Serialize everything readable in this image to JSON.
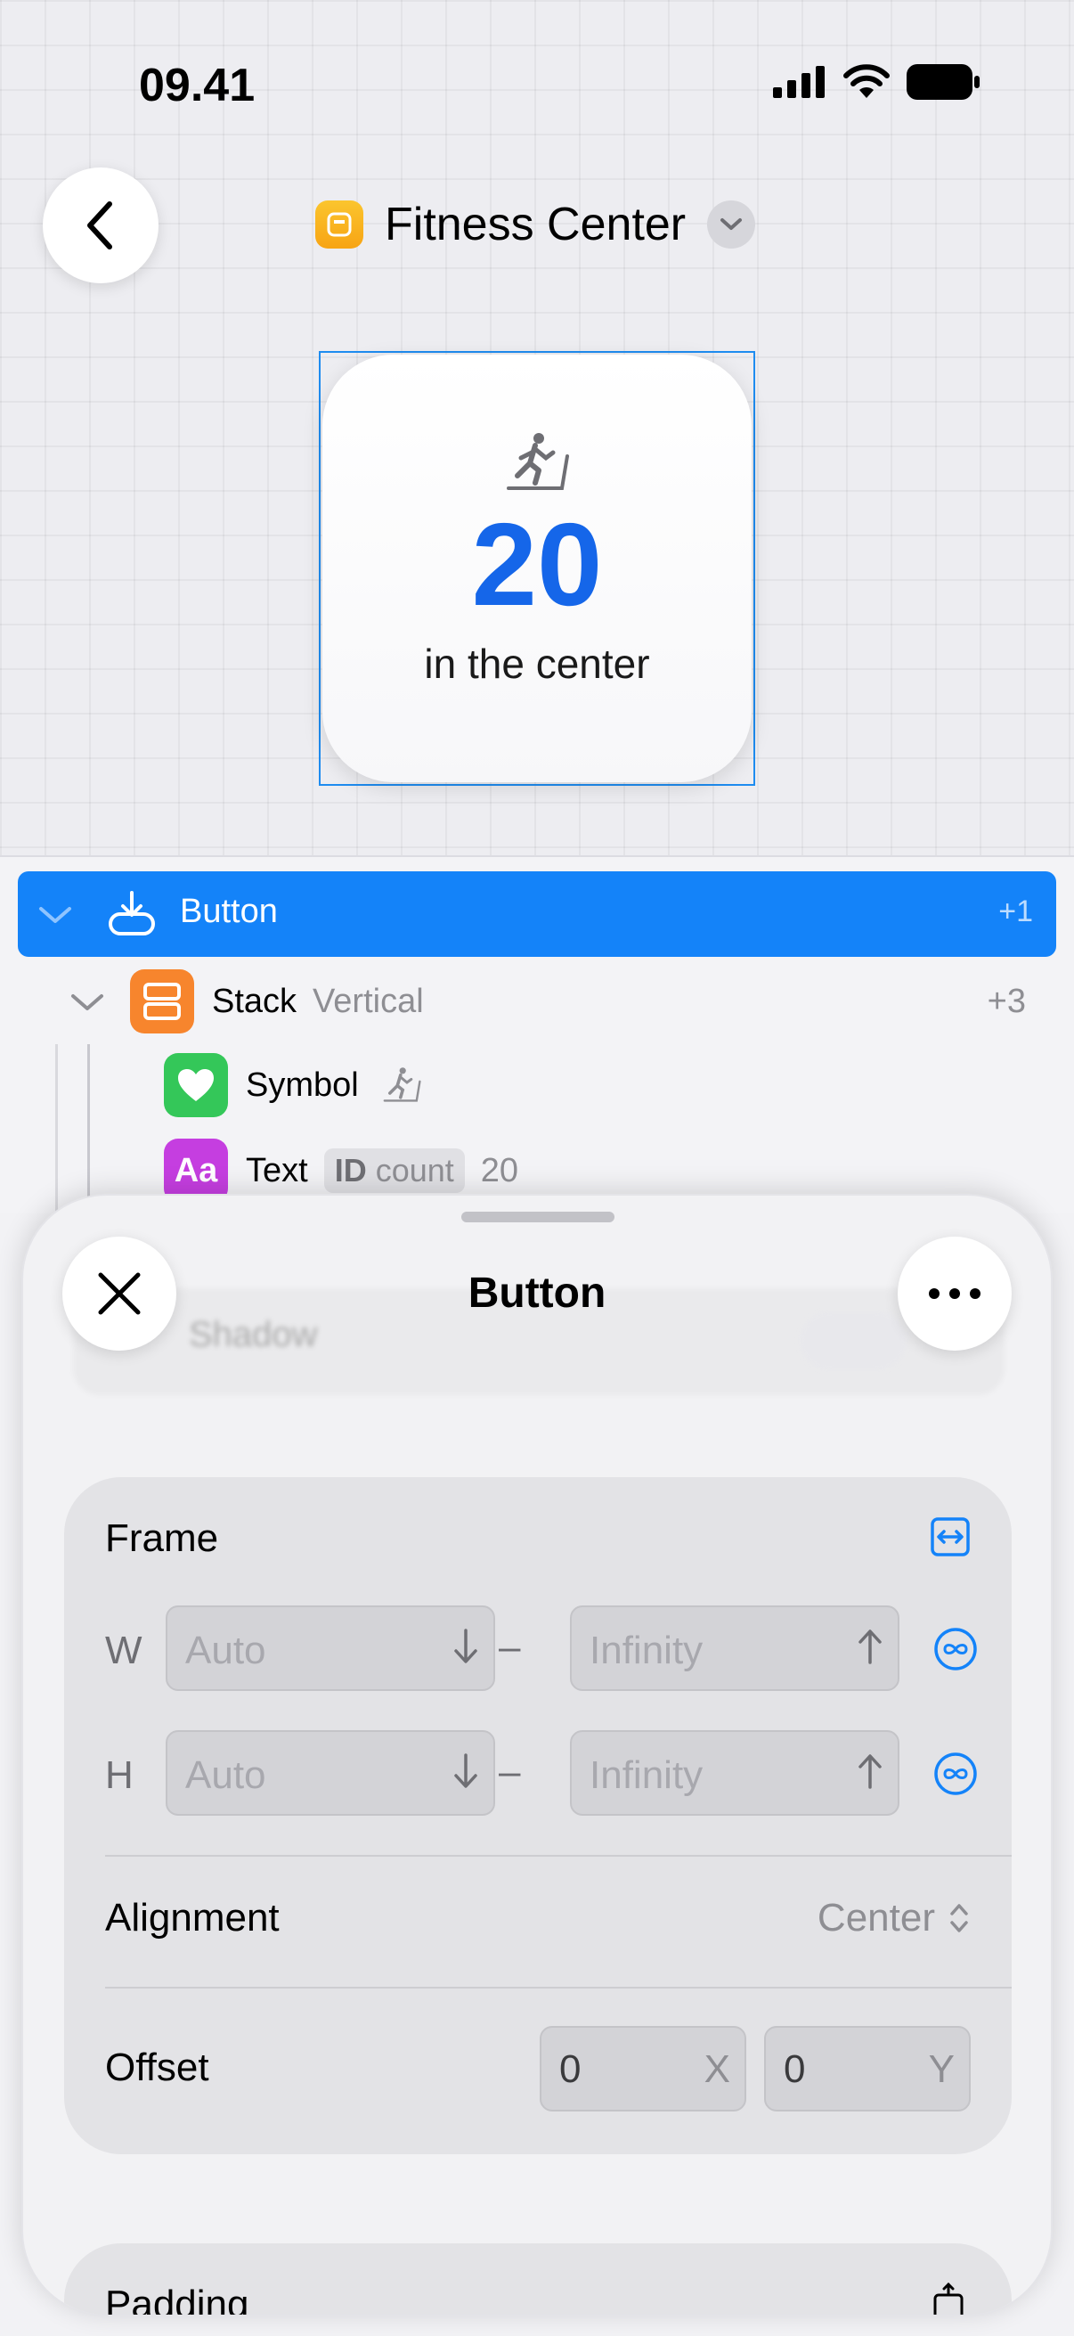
{
  "status": {
    "time": "09.41"
  },
  "header": {
    "title": "Fitness Center"
  },
  "widget": {
    "count": "20",
    "label": "in the center"
  },
  "tree": {
    "selected": {
      "label": "Button",
      "count": "+1"
    },
    "stack": {
      "label": "Stack",
      "sub": "Vertical",
      "count": "+3"
    },
    "symbol": {
      "label": "Symbol"
    },
    "text": {
      "label": "Text",
      "id_prefix": "ID",
      "id_name": "count",
      "value": "20"
    }
  },
  "sheet": {
    "title": "Button",
    "ghost_label": "Shadow",
    "frame": {
      "title": "Frame",
      "w_letter": "W",
      "h_letter": "H",
      "min_placeholder": "Auto",
      "max_placeholder": "Infinity",
      "dash": "–"
    },
    "alignment": {
      "label": "Alignment",
      "value": "Center"
    },
    "offset": {
      "label": "Offset",
      "x_value": "0",
      "x_axis": "X",
      "y_value": "0",
      "y_axis": "Y"
    },
    "next_section": "Padding"
  },
  "colors": {
    "accent": "#1483f9",
    "widget_number": "#1566e9",
    "stack_badge": "#f7852d",
    "symbol_badge": "#34c759",
    "text_badge": "#c53ee0"
  }
}
